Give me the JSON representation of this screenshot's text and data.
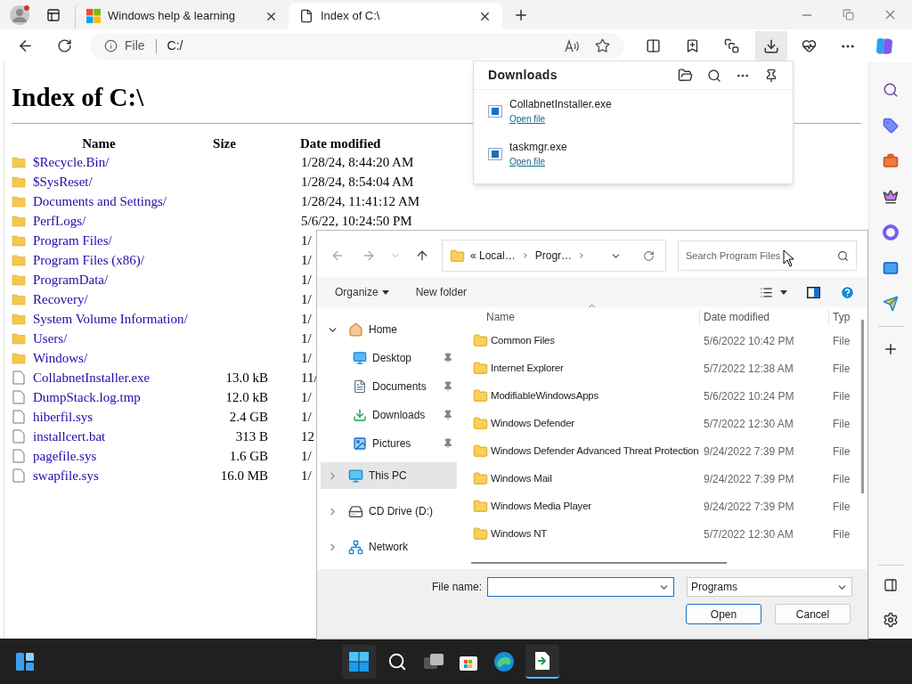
{
  "browser": {
    "tabs": [
      {
        "title": "Windows help & learning",
        "selected": false,
        "kind": "web"
      },
      {
        "title": "Index of C:\\",
        "selected": true,
        "kind": "file"
      }
    ],
    "address": {
      "scheme": "File",
      "url": "C:/"
    }
  },
  "page": {
    "title": "Index of C:\\",
    "columns": [
      "Name",
      "Size",
      "Date modified"
    ],
    "rows": [
      {
        "name": "$Recycle.Bin/",
        "kind": "folder",
        "date": "1/28/24, 8:44:20 AM"
      },
      {
        "name": "$SysReset/",
        "kind": "folder",
        "date": "1/28/24, 8:54:04 AM"
      },
      {
        "name": "Documents and Settings/",
        "kind": "folder",
        "date": "1/28/24, 11:41:12 AM"
      },
      {
        "name": "PerfLogs/",
        "kind": "folder",
        "date": "5/6/22, 10:24:50 PM"
      },
      {
        "name": "Program Files/",
        "kind": "folder",
        "date": "1/"
      },
      {
        "name": "Program Files (x86)/",
        "kind": "folder",
        "date": "1/"
      },
      {
        "name": "ProgramData/",
        "kind": "folder",
        "date": "1/"
      },
      {
        "name": "Recovery/",
        "kind": "folder",
        "date": "1/"
      },
      {
        "name": "System Volume Information/",
        "kind": "folder",
        "date": "1/"
      },
      {
        "name": "Users/",
        "kind": "folder",
        "date": "1/"
      },
      {
        "name": "Windows/",
        "kind": "folder",
        "date": "1/"
      },
      {
        "name": "CollabnetInstaller.exe",
        "kind": "file",
        "size": "13.0 kB",
        "date": "11/"
      },
      {
        "name": "DumpStack.log.tmp",
        "kind": "file",
        "size": "12.0 kB",
        "date": "1/"
      },
      {
        "name": "hiberfil.sys",
        "kind": "file",
        "size": "2.4 GB",
        "date": "1/"
      },
      {
        "name": "installcert.bat",
        "kind": "file",
        "size": "313 B",
        "date": "12"
      },
      {
        "name": "pagefile.sys",
        "kind": "file",
        "size": "1.6 GB",
        "date": "1/"
      },
      {
        "name": "swapfile.sys",
        "kind": "file",
        "size": "16.0 MB",
        "date": "1/"
      }
    ]
  },
  "downloads": {
    "title": "Downloads",
    "items": [
      {
        "name": "CollabnetInstaller.exe",
        "action": "Open file"
      },
      {
        "name": "taskmgr.exe",
        "action": "Open file"
      }
    ]
  },
  "dialog": {
    "breadcrumb": [
      "« Local…",
      "Progr…"
    ],
    "search": {
      "placeholder": "Search Program Files"
    },
    "toolbar": {
      "organize": "Organize",
      "new_folder": "New folder"
    },
    "nav": [
      {
        "label": "Home",
        "kind": "home",
        "expanded": true,
        "selected": false,
        "children": [
          {
            "label": "Desktop",
            "kind": "desktop",
            "pinned": true,
            "selected": false
          },
          {
            "label": "Documents",
            "kind": "documents",
            "pinned": true,
            "selected": false
          },
          {
            "label": "Downloads",
            "kind": "downloads",
            "pinned": true,
            "selected": false
          },
          {
            "label": "Pictures",
            "kind": "pictures",
            "pinned": true,
            "selected": false
          }
        ]
      },
      {
        "label": "This PC",
        "kind": "pc",
        "expanded": false,
        "selected": true
      },
      {
        "label": "CD Drive (D:)",
        "kind": "drive",
        "expanded": false,
        "selected": false
      },
      {
        "label": "Network",
        "kind": "network",
        "expanded": false,
        "selected": false
      }
    ],
    "columns": [
      "Name",
      "Date modified",
      "Typ"
    ],
    "rows": [
      {
        "name": "Common Files",
        "date": "5/6/2022 10:42 PM",
        "type": "File"
      },
      {
        "name": "Internet Explorer",
        "date": "5/7/2022 12:38 AM",
        "type": "File"
      },
      {
        "name": "ModifiableWindowsApps",
        "date": "5/6/2022 10:24 PM",
        "type": "File"
      },
      {
        "name": "Windows Defender",
        "date": "5/7/2022 12:30 AM",
        "type": "File"
      },
      {
        "name": "Windows Defender Advanced Threat Protection",
        "date": "9/24/2022 7:39 PM",
        "type": "File"
      },
      {
        "name": "Windows Mail",
        "date": "9/24/2022 7:39 PM",
        "type": "File"
      },
      {
        "name": "Windows Media Player",
        "date": "9/24/2022 7:39 PM",
        "type": "File"
      },
      {
        "name": "Windows NT",
        "date": "5/7/2022 12:30 AM",
        "type": "File"
      }
    ],
    "file_name_label": "File name:",
    "filter": "Programs",
    "buttons": [
      "Open",
      "Cancel"
    ]
  }
}
